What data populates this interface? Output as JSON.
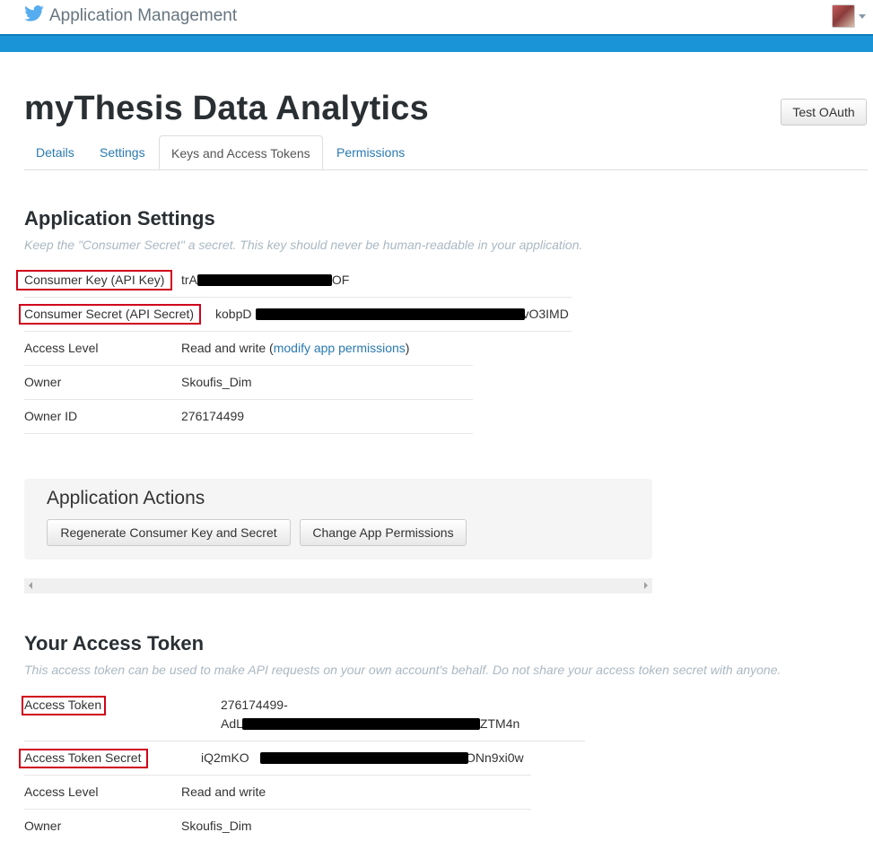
{
  "topbar": {
    "title": "Application Management",
    "icon": "twitter-bird-icon"
  },
  "page": {
    "title": "myThesis Data Analytics",
    "test_oauth_label": "Test OAuth"
  },
  "tabs": [
    {
      "label": "Details",
      "active": false
    },
    {
      "label": "Settings",
      "active": false
    },
    {
      "label": "Keys and Access Tokens",
      "active": true
    },
    {
      "label": "Permissions",
      "active": false
    }
  ],
  "app_settings": {
    "heading": "Application Settings",
    "hint": "Keep the \"Consumer Secret\" a secret. This key should never be human-readable in your application.",
    "consumer_key": {
      "label": "Consumer Key (API Key)",
      "value_start": "trA",
      "value_end": "OF"
    },
    "consumer_secret": {
      "label": "Consumer Secret (API Secret)",
      "value_start": "kobpD",
      "value_end": "vO3IMD"
    },
    "access_level": {
      "label": "Access Level",
      "value": "Read and write (",
      "link": "modify app permissions",
      "suffix": ")"
    },
    "owner": {
      "label": "Owner",
      "value": "Skoufis_Dim"
    },
    "owner_id": {
      "label": "Owner ID",
      "value": "276174499"
    }
  },
  "app_actions": {
    "heading": "Application Actions",
    "regenerate_label": "Regenerate Consumer Key and Secret",
    "change_permissions_label": "Change App Permissions"
  },
  "access_token": {
    "heading": "Your Access Token",
    "hint": "This access token can be used to make API requests on your own account's behalf. Do not share your access token secret with anyone.",
    "token": {
      "label": "Access Token",
      "value_line1": "276174499-",
      "value_start": "AdL",
      "value_end": "ZTM4n"
    },
    "token_secret": {
      "label": "Access Token Secret",
      "value_start": "iQ2mKO",
      "value_end": "AONn9xi0w"
    },
    "access_level": {
      "label": "Access Level",
      "value": "Read and write"
    },
    "owner": {
      "label": "Owner",
      "value": "Skoufis_Dim"
    }
  },
  "colors": {
    "accent_blue": "#1a94d6",
    "link": "#2a7ab0",
    "highlight_red": "#d0021b"
  }
}
